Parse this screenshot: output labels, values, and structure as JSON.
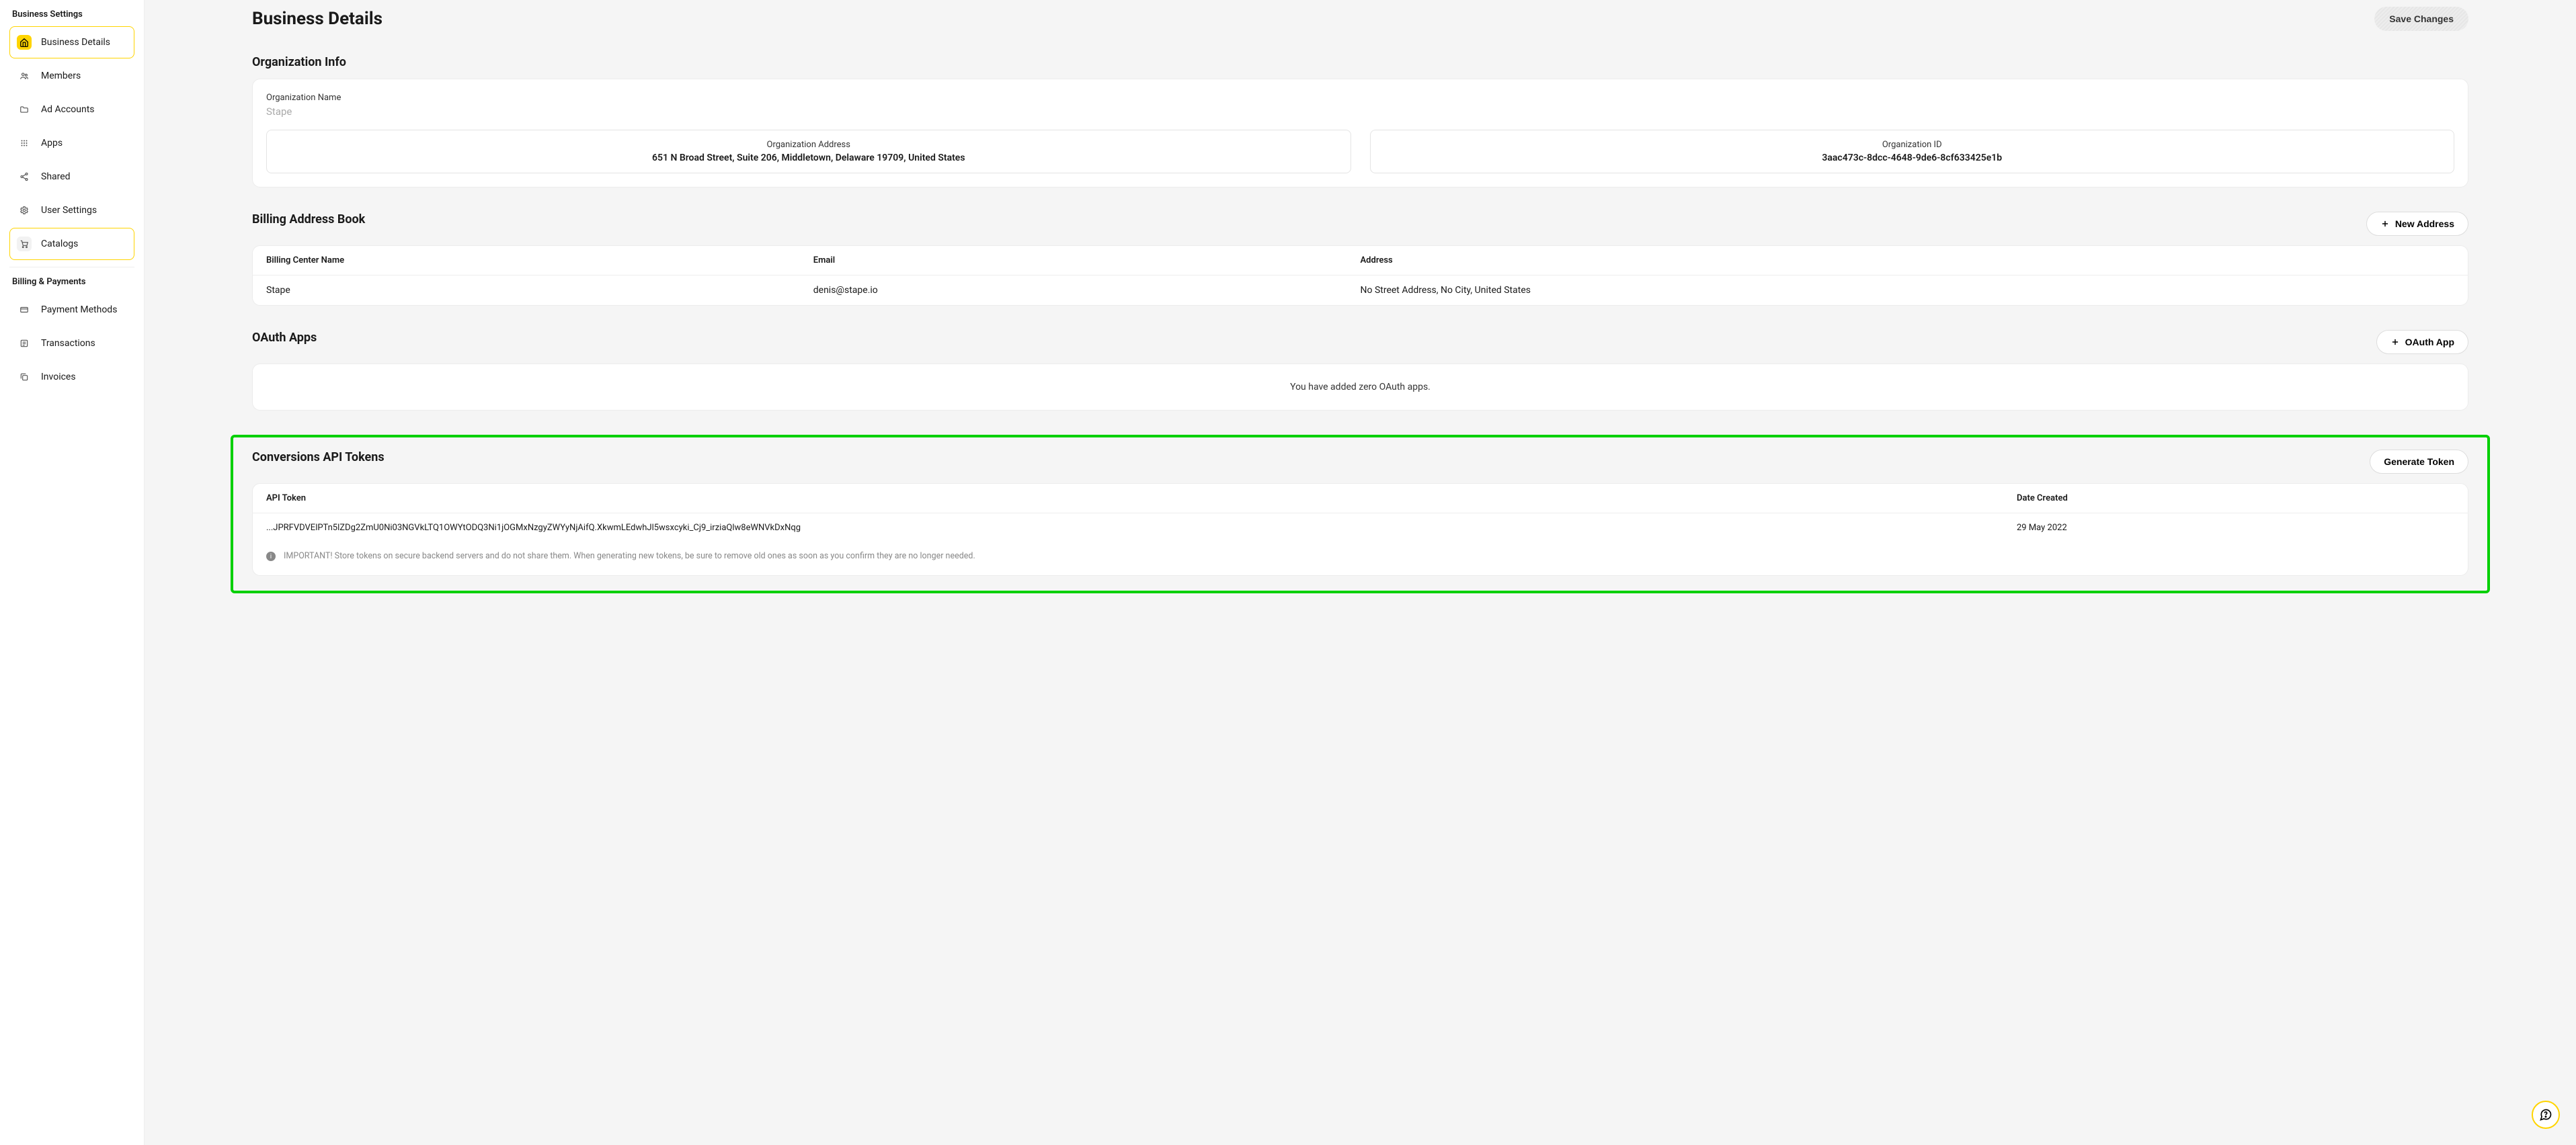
{
  "sidebar": {
    "section1_title": "Business Settings",
    "section2_title": "Billing & Payments",
    "items_business": [
      {
        "label": "Business Details",
        "icon": "home"
      },
      {
        "label": "Members",
        "icon": "members"
      },
      {
        "label": "Ad Accounts",
        "icon": "folder"
      },
      {
        "label": "Apps",
        "icon": "grid"
      },
      {
        "label": "Shared",
        "icon": "share"
      },
      {
        "label": "User Settings",
        "icon": "gear"
      },
      {
        "label": "Catalogs",
        "icon": "cart"
      }
    ],
    "items_billing": [
      {
        "label": "Payment Methods",
        "icon": "card"
      },
      {
        "label": "Transactions",
        "icon": "list"
      },
      {
        "label": "Invoices",
        "icon": "copy"
      }
    ]
  },
  "header": {
    "title": "Business Details",
    "save_label": "Save Changes"
  },
  "org_info": {
    "title": "Organization Info",
    "name_label": "Organization Name",
    "name_value": "Stape",
    "address_label": "Organization Address",
    "address_value": "651 N Broad Street, Suite 206, Middletown, Delaware 19709, United States",
    "id_label": "Organization ID",
    "id_value": "3aac473c-8dcc-4648-9de6-8cf633425e1b"
  },
  "billing": {
    "title": "Billing Address Book",
    "new_address_label": "New Address",
    "col_name": "Billing Center Name",
    "col_email": "Email",
    "col_address": "Address",
    "rows": [
      {
        "name": "Stape",
        "email": "denis@stape.io",
        "address": "No Street Address, No City, United States"
      }
    ]
  },
  "oauth": {
    "title": "OAuth Apps",
    "button_label": "OAuth App",
    "empty_text": "You have added zero OAuth apps."
  },
  "tokens": {
    "title": "Conversions API Tokens",
    "button_label": "Generate Token",
    "col_token": "API Token",
    "col_date": "Date Created",
    "rows": [
      {
        "token": "...JPRFVDVElPTn5lZDg2ZmU0Ni03NGVkLTQ1OWYtODQ3Ni1jOGMxNzgyZWYyNjAifQ.XkwmLEdwhJl5wsxcyki_Cj9_irziaQlw8eWNVkDxNqg",
        "date": "29 May 2022"
      }
    ],
    "note": "IMPORTANT! Store tokens on secure backend servers and do not share them. When generating new tokens, be sure to remove old ones as soon as you confirm they are no longer needed."
  }
}
